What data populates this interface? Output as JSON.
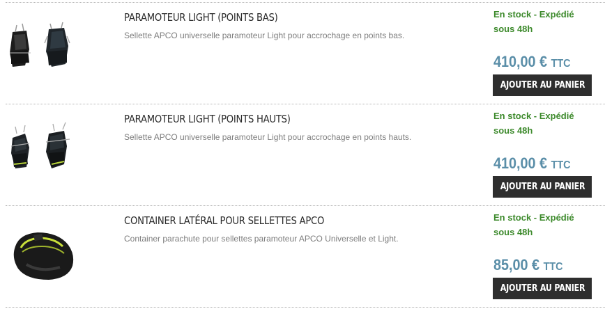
{
  "products": [
    {
      "title": "PARAMOTEUR LIGHT (POINTS BAS)",
      "description": "Sellette APCO universelle paramoteur Light pour accrochage en points bas.",
      "stock_line1": "En stock - Expédié",
      "stock_line2": "sous 48h",
      "price": "410,00 €",
      "price_suffix": "TTC",
      "button": "AJOUTER AU PANIER",
      "image": "paramotor-harness-photo"
    },
    {
      "title": "PARAMOTEUR LIGHT (POINTS HAUTS)",
      "description": "Sellette APCO universelle paramoteur Light pour accrochage en points hauts.",
      "stock_line1": "En stock - Expédié",
      "stock_line2": "sous 48h",
      "price": "410,00 €",
      "price_suffix": "TTC",
      "button": "AJOUTER AU PANIER",
      "image": "paramotor-harness-photo"
    },
    {
      "title": "CONTAINER LATÉRAL POUR SELLETTES APCO",
      "description": "Container parachute pour sellettes paramoteur APCO Universelle et Light.",
      "stock_line1": "En stock - Expédié",
      "stock_line2": "sous 48h",
      "price": "85,00 €",
      "price_suffix": "TTC",
      "button": "AJOUTER AU PANIER",
      "image": "reserve-container-photo"
    }
  ],
  "colors": {
    "stock": "#3d8a2c",
    "price": "#5a8ea8",
    "button_bg": "#2e2e2e",
    "title": "#2b2b2b",
    "description": "#7d7d7d"
  }
}
